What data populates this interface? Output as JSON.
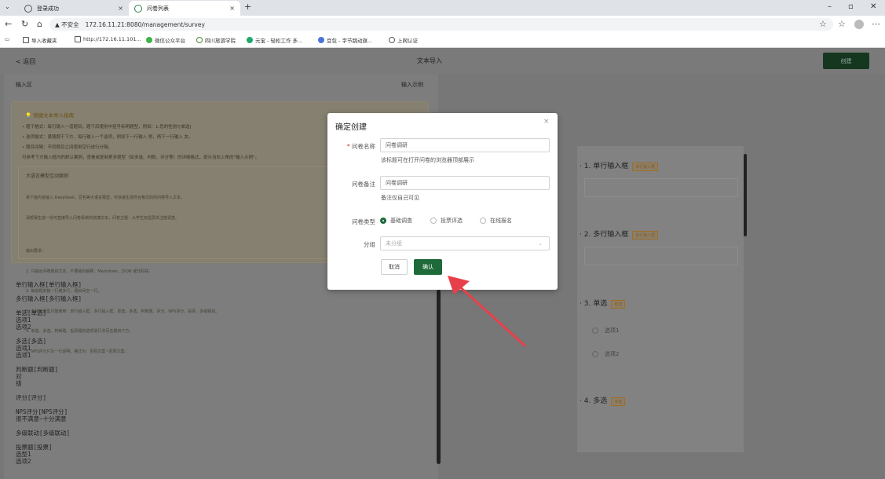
{
  "browser": {
    "tabs": [
      {
        "title": "登录成功"
      },
      {
        "title": "问卷列表"
      }
    ],
    "security_label": "不安全",
    "url": "172.16.11.21:8080/management/survey",
    "bookmarks": [
      "导入收藏夹",
      "http://172.16.11.101...",
      "微信公众平台",
      "四川旅游学院",
      "元宝 - 轻松工作 多...",
      "豆包 - 字节跳动旗...",
      "上网认证"
    ]
  },
  "header": {
    "back": "< 返回",
    "title": "文本导入",
    "create_button": "创建"
  },
  "left": {
    "input_area": "输入区",
    "example_label": "输入示例",
    "guide_title": "快捷文本导入指南",
    "guide_lines": [
      "• 题干格式：每行输入一道题目，题干后使用中括号标明题型，例如：1.您的性别?[单选]",
      "• 选项格式：紧随题干下方，每行输入一个选项，例如下一行输入 男，再下一行输入 女。",
      "• 题目间隔：不同题目之间使用空行进行分隔。",
      "可参考下方输入框内的默认案例，查看或复制更多题型（如多选、判断、评分等）的详细格式，提示当右上角的\"输入示例\"。"
    ],
    "ai_title": "大语言模型互动案例",
    "ai_lines": [
      "将下面内容输入 DeepSeek、豆包等大语言模型，可快速生成符合格式的的问卷导入文本。",
      "请帮我生成一份可直接导入问卷系统的快捷文本，问卷主题：大学生双显屏关注度调查。",
      "",
      "输出要求：",
      "1. 只输出问卷题目文本，不要输出解释、Markdown、JSON 或代码块。",
      "2. 每道题单独一行或多行，题目间空一行。",
      "3. 支持的题型只能使用：单行输入框、多行输入框、单选、多选、判断题、评分、NPS评分、投票、多级联动。",
      "4. 单选、多选、判断题、投票题的选项逐行书写在题目下方。",
      "5. NPS评分只写一行说明，格式为：否则文案~否则文案。"
    ],
    "text_lines": [
      "单行输入框[单行输入框]",
      "",
      "多行输入框[多行输入框]",
      "",
      "单选[单选]",
      "选项1",
      "选项2",
      "",
      "多选[多选]",
      "选项1",
      "选项1",
      "",
      "判断题[判断题]",
      "对",
      "错",
      "",
      "评分[评分]",
      "",
      "NPS评分[NPS评分]",
      "很不满意~十分满意",
      "",
      "多级联动[多级联动]",
      "",
      "投票题[投票]",
      "选型1",
      "选项2"
    ]
  },
  "preview": {
    "questions": [
      {
        "num": "1.",
        "title": "单行输入框",
        "tag": "单行输入框"
      },
      {
        "num": "2.",
        "title": "多行输入框",
        "tag": "多行输入框"
      },
      {
        "num": "3.",
        "title": "单选",
        "tag": "单选",
        "options": [
          "选项1",
          "选项2"
        ]
      },
      {
        "num": "4.",
        "title": "多选",
        "tag": "多选"
      }
    ]
  },
  "modal": {
    "title": "确定创建",
    "name_label": "问卷名称",
    "name_value": "问卷调研",
    "name_hint": "该标题可在打开问卷的浏览器顶部展示",
    "note_label": "问卷备注",
    "note_value": "问卷调研",
    "note_hint": "备注仅自己可见",
    "type_label": "问卷类型",
    "types": [
      "基础调查",
      "投票评选",
      "在线报名"
    ],
    "group_label": "分组",
    "group_placeholder": "未分组",
    "cancel": "取消",
    "confirm": "确认"
  },
  "colors": {
    "brand": "#1e6a3a",
    "arrow": "#e8404a"
  }
}
